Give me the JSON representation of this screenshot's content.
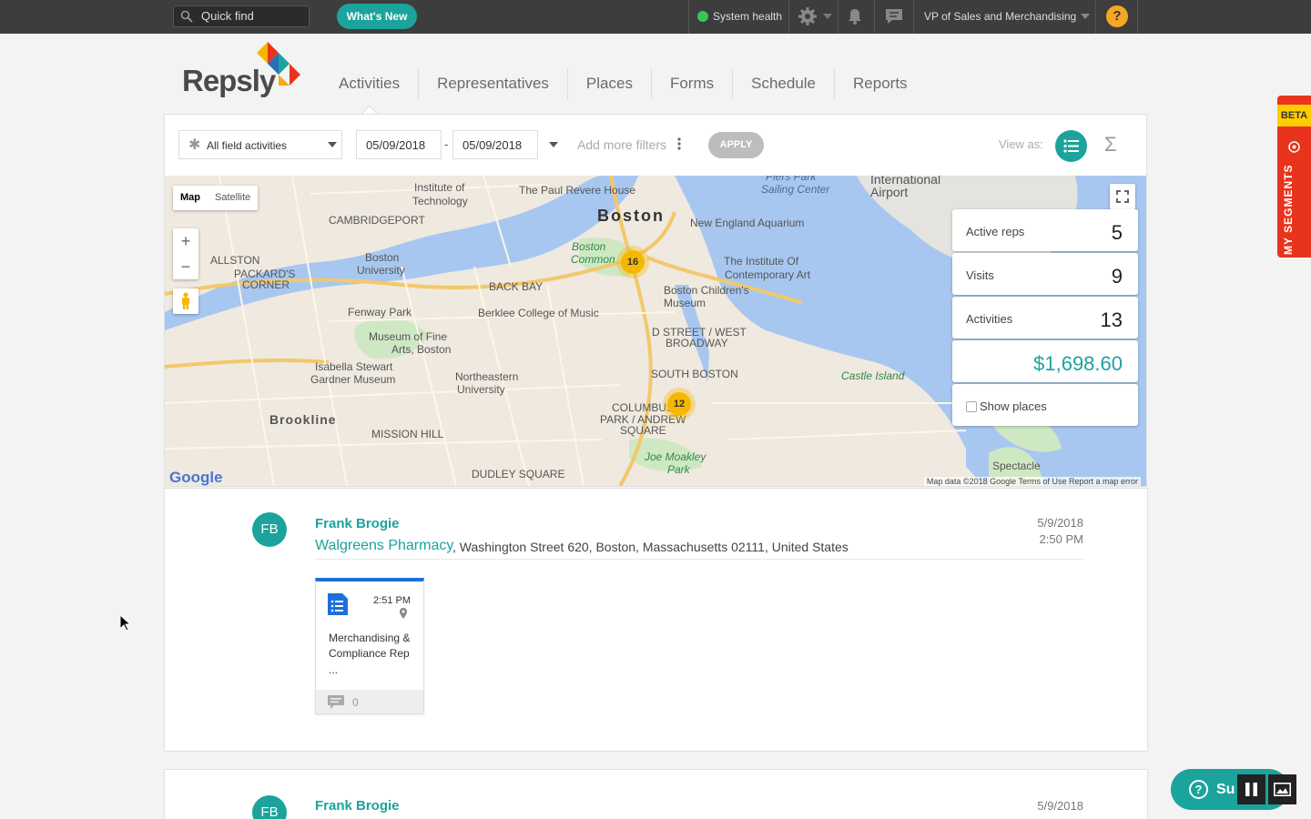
{
  "topbar": {
    "quick_find_placeholder": "Quick find",
    "whats_new": "What's New",
    "system_health": "System health",
    "role": "VP of Sales and Merchandising",
    "help": "?"
  },
  "logo": {
    "text": "Repsly"
  },
  "nav": {
    "items": [
      "Activities",
      "Representatives",
      "Places",
      "Forms",
      "Schedule",
      "Reports"
    ],
    "active": "Activities"
  },
  "filters": {
    "activity_type": "All field activities",
    "date_from": "05/09/2018",
    "date_separator": "-",
    "date_to": "05/09/2018",
    "add_more_filters": "Add more filters",
    "apply": "APPLY",
    "view_as": "View as:"
  },
  "map": {
    "type_map": "Map",
    "type_satellite": "Satellite",
    "zoom_in": "+",
    "zoom_out": "−",
    "google": "Google",
    "attribution": "Map data ©2018 Google   Terms of Use   Report a map error",
    "labels": {
      "boston": "Boston",
      "cambridgeport": "CAMBRIDGEPORT",
      "allston": "ALLSTON",
      "packards": "PACKARD'S",
      "corner": "CORNER",
      "bu1": "Boston",
      "bu2": "University",
      "back_bay": "BACK BAY",
      "fenway": "Fenway Park",
      "berklee": "Berklee College of Music",
      "mfa1": "Museum of Fine",
      "mfa2": "Arts, Boston",
      "gardner1": "Isabella Stewart",
      "gardner2": "Gardner Museum",
      "neu1": "Northeastern",
      "neu2": "University",
      "brookline": "Brookline",
      "mission_hill": "MISSION HILL",
      "dudley": "DUDLEY SQUARE",
      "mit1": "Institute of",
      "mit2": "Technology",
      "revere": "The Paul Revere House",
      "aquarium": "New England Aquarium",
      "ica1": "The Institute Of",
      "ica2": "Contemporary Art",
      "childrens1": "Boston Children's",
      "childrens2": "Museum",
      "dstreet1": "D STREET / WEST",
      "dstreet2": "BROADWAY",
      "southboston": "SOUTH BOSTON",
      "columbus1": "COLUMBUS",
      "columbus2": "PARK / ANDREW",
      "columbus3": "SQUARE",
      "moakley1": "Joe Moakley",
      "moakley2": "Park",
      "castle": "Castle Island",
      "spectacle": "Spectacle",
      "airport1": "International",
      "airport2": "Airport",
      "sailing1": "Piers Park",
      "sailing2": "Sailing Center",
      "common1": "Boston",
      "common2": "Common"
    },
    "clusters": [
      16,
      12
    ]
  },
  "stats": {
    "active_reps_label": "Active reps",
    "active_reps": "5",
    "visits_label": "Visits",
    "visits": "9",
    "activities_label": "Activities",
    "activities": "13",
    "revenue": "$1,698.60",
    "show_places": "Show places"
  },
  "feed": [
    {
      "initials": "FB",
      "rep": "Frank Brogie",
      "place": "Walgreens Pharmacy",
      "address": ", Washington Street 620, Boston, Massachusetts 02111, United States",
      "date": "5/9/2018",
      "time": "2:50 PM",
      "activity": {
        "time": "2:51 PM",
        "title": "Merchandising & Compliance Rep",
        "ellipsis": "...",
        "comments": "0"
      }
    },
    {
      "initials": "FB",
      "rep": "Frank Brogie",
      "date": "5/9/2018"
    }
  ],
  "beta": {
    "badge": "BETA",
    "label": "MY SEGMENTS"
  },
  "support": {
    "label": "Su"
  },
  "colors": {
    "accent": "#1ba39c",
    "topbar": "#3d3d3d",
    "beta": "#e8341c"
  }
}
